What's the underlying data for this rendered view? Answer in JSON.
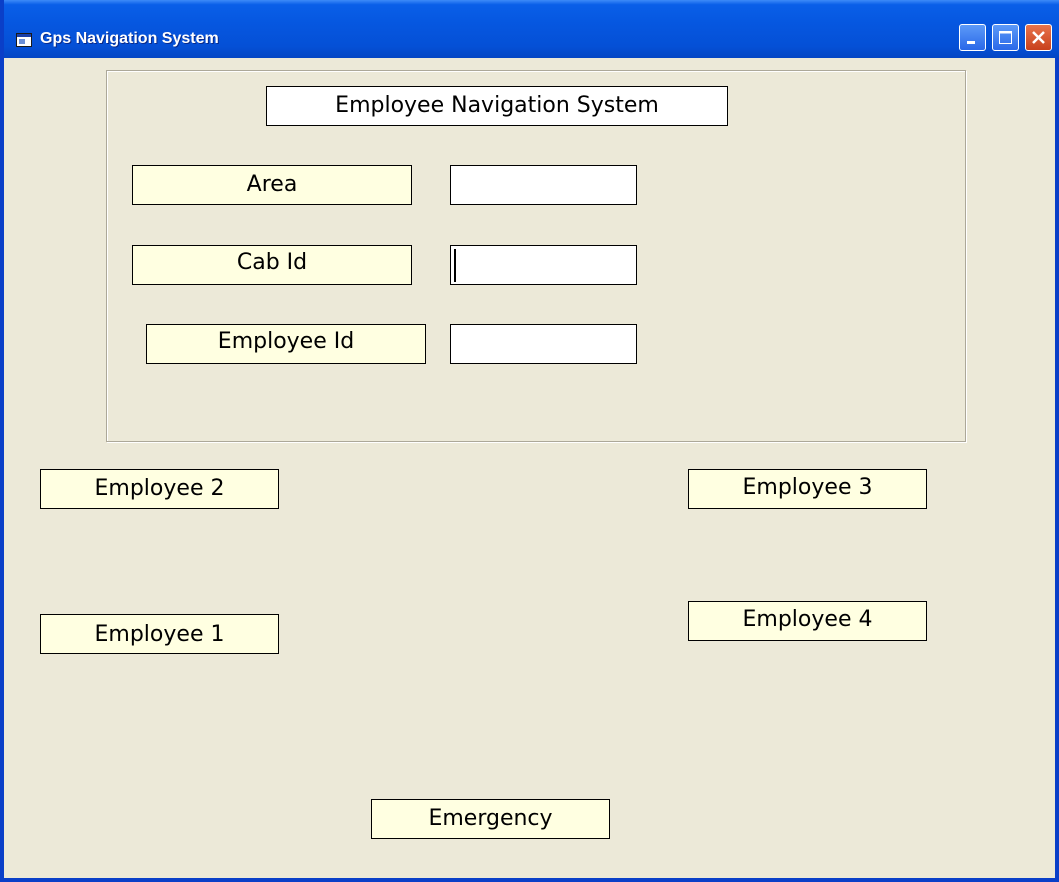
{
  "window": {
    "title": "Gps Navigation System",
    "icon": "app-window-icon",
    "controls": [
      "minimize-icon",
      "maximize-icon",
      "close-icon"
    ]
  },
  "form": {
    "heading": "Employee Navigation System",
    "fields": [
      {
        "label": "Area",
        "value": ""
      },
      {
        "label": "Cab Id",
        "value": ""
      },
      {
        "label": "Employee Id",
        "value": ""
      }
    ]
  },
  "employees": {
    "employee2": "Employee 2",
    "employee3": "Employee 3",
    "employee1": "Employee 1",
    "employee4": "Employee 4"
  },
  "emergency": "Emergency",
  "colors": {
    "title_bar": "#0A5FE8",
    "window_bg": "#ECE9D8",
    "label_bg": "#FFFFE1",
    "close_button": "#D8552C"
  }
}
